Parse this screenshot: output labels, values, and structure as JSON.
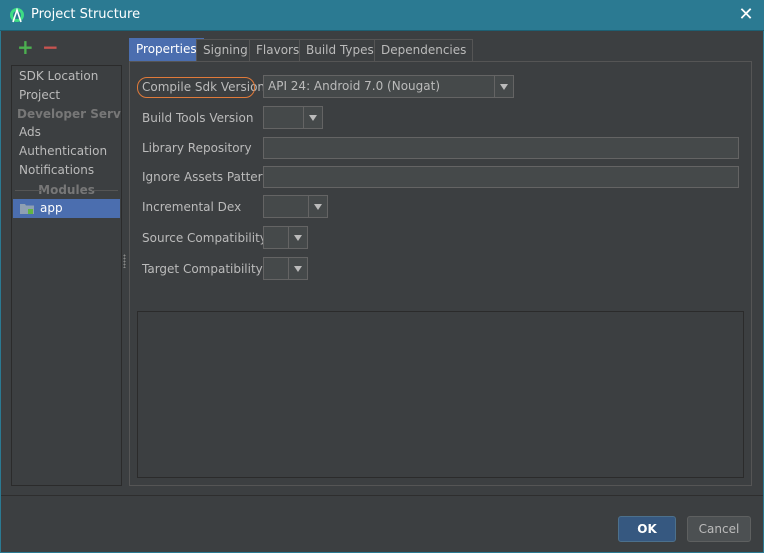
{
  "window": {
    "title": "Project Structure",
    "close_glyph": "✕",
    "title_icon": "android-studio-icon"
  },
  "left_toolbar": {
    "add_glyph": "+",
    "remove_glyph": "−"
  },
  "sidebar": {
    "items": [
      "SDK Location",
      "Project"
    ],
    "developer_header": "Developer Servi...",
    "developer_items": [
      "Ads",
      "Authentication",
      "Notifications"
    ],
    "modules_header": "Modules",
    "module_items": [
      "app"
    ]
  },
  "tabs": [
    "Properties",
    "Signing",
    "Flavors",
    "Build Types",
    "Dependencies"
  ],
  "active_tab": "Properties",
  "form": {
    "compile_sdk_label": "Compile Sdk Version",
    "compile_sdk_value": "API 24: Android 7.0 (Nougat)",
    "build_tools_label": "Build Tools Version",
    "build_tools_value": "",
    "library_repo_label": "Library Repository",
    "library_repo_value": "",
    "ignore_assets_label": "Ignore Assets Pattern",
    "ignore_assets_value": "",
    "incremental_dex_label": "Incremental Dex",
    "incremental_dex_value": "",
    "source_compat_label": "Source Compatibility",
    "source_compat_value": "",
    "target_compat_label": "Target Compatibility",
    "target_compat_value": ""
  },
  "buttons": {
    "ok": "OK",
    "cancel": "Cancel"
  },
  "colors": {
    "titlebar": "#2b7a92",
    "selection": "#4b6eaf",
    "highlight_ring": "#e07a3a",
    "add": "#4caf50",
    "remove": "#c75450"
  }
}
